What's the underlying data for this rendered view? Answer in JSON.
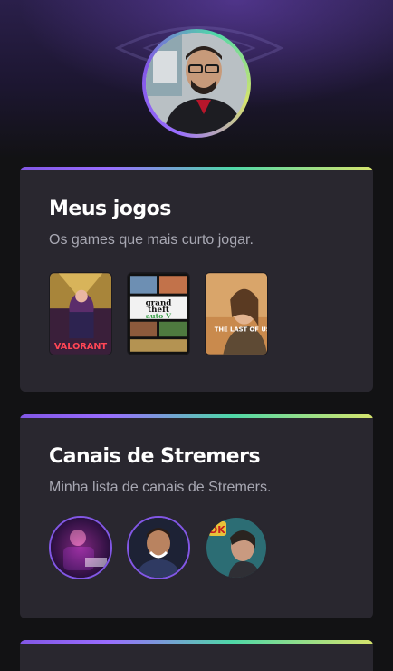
{
  "profile": {
    "avatar_alt": "Foto de perfil"
  },
  "cards": [
    {
      "title": "Meus jogos",
      "subtitle": "Os games que mais curto jogar.",
      "games": [
        {
          "name": "Valorant",
          "cover_text": "VALORANT",
          "color": "#ff4655"
        },
        {
          "name": "GTA V",
          "cover_text": "grand theft auto",
          "color": "#3aa14a"
        },
        {
          "name": "The Last of Us",
          "cover_text": "THE LAST OF US",
          "color": "#c98a4d"
        }
      ]
    },
    {
      "title": "Canais de Stremers",
      "subtitle": "Minha lista de canais de Stremers.",
      "streamers": [
        {
          "name": "streamer-1"
        },
        {
          "name": "streamer-2"
        },
        {
          "name": "streamer-3",
          "badge": "DK"
        }
      ]
    }
  ],
  "colors": {
    "background": "#121214",
    "card": "#29272f",
    "accent_purple": "#8257e5",
    "accent_green": "#4fd8a8",
    "accent_yellow": "#d6e46d",
    "title": "#ffffff",
    "subtitle": "#a8a8b3"
  }
}
